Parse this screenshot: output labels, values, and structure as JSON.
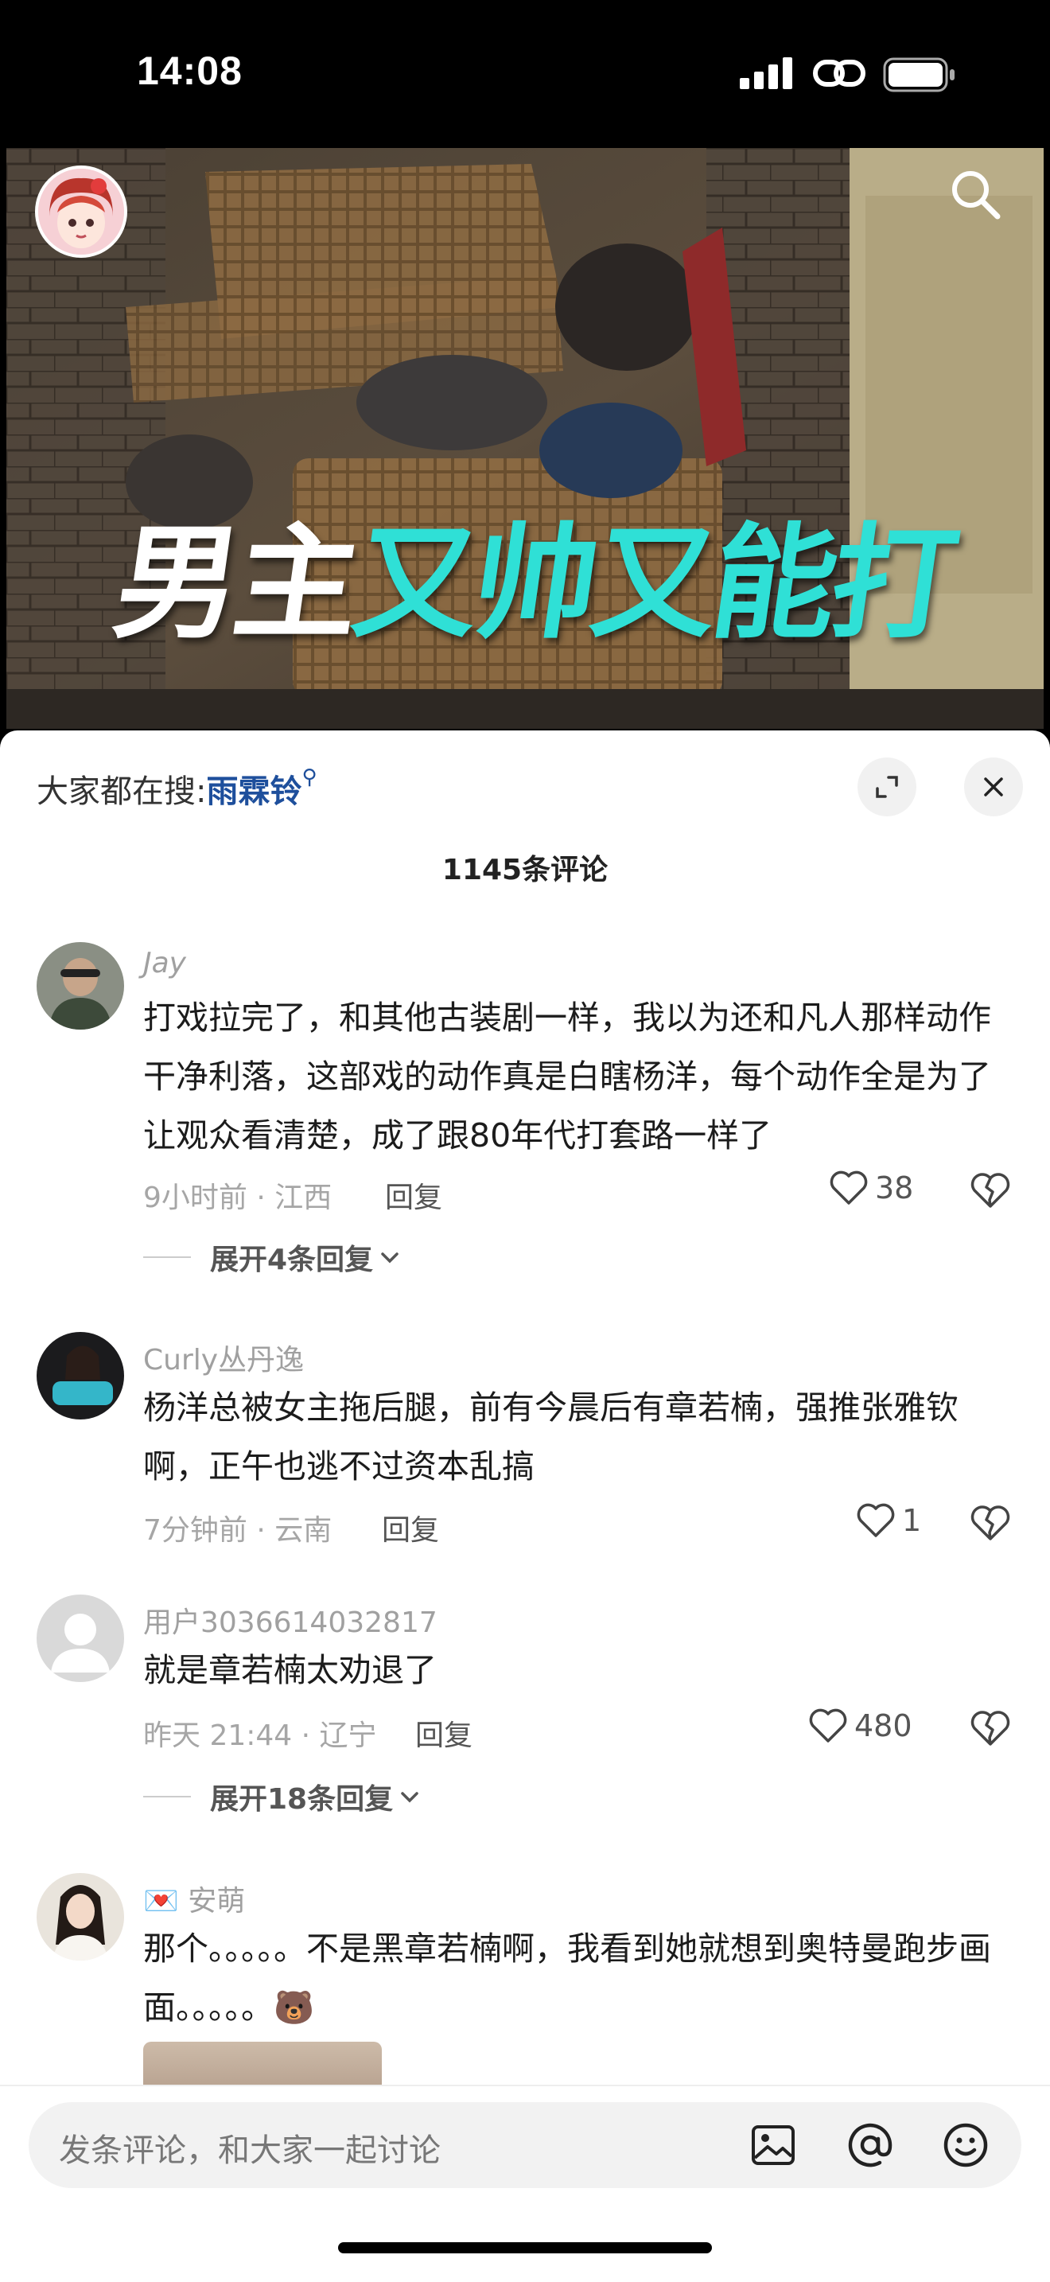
{
  "status": {
    "time": "14:08"
  },
  "video": {
    "caption_white": "男主",
    "caption_cyan": "又帅又能打"
  },
  "sheet": {
    "hot_search_prefix": "大家都在搜:",
    "hot_search_keyword": "雨霖铃",
    "comment_count_title": "1145条评论"
  },
  "comments": [
    {
      "user": "Jay",
      "text": "打戏拉完了，和其他古装剧一样，我以为还和凡人那样动作干净利落，这部戏的动作真是白瞎杨洋，每个动作全是为了让观众看清楚，成了跟80年代打套路一样了",
      "time_location": "9小时前 · 江西",
      "reply_label": "回复",
      "likes": "38",
      "expand_label": "展开4条回复"
    },
    {
      "user": "Curly丛丹逸",
      "text": "杨洋总被女主拖后腿，前有今晨后有章若楠，强推张雅钦啊，正午也逃不过资本乱搞",
      "time_location": "7分钟前 · 云南",
      "reply_label": "回复",
      "likes": "1"
    },
    {
      "user": "用户3036614032817",
      "text": "就是章若楠太劝退了",
      "time_location": "昨天 21:44 · 辽宁",
      "reply_label": "回复",
      "likes": "480",
      "expand_label": "展开18条回复"
    },
    {
      "user": "安萌",
      "user_badge": "💌",
      "text": "那个。。。。。不是黑章若楠啊，我看到她就想到奥特曼跑步画面。。。。。🐻"
    }
  ],
  "input": {
    "placeholder": "发条评论，和大家一起讨论"
  },
  "colors": {
    "caption_cyan": "#2fe0d6",
    "hot_keyword": "#1e4f9c"
  }
}
